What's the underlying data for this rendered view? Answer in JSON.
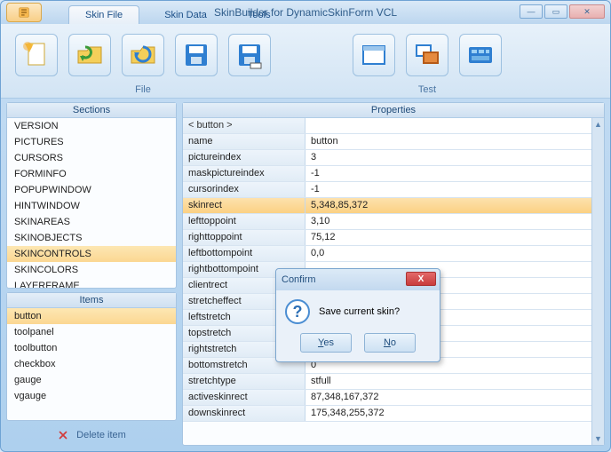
{
  "title": "SkinBuilder for DynamicSkinForm VCL",
  "tabs": [
    {
      "label": "Skin File",
      "active": true
    },
    {
      "label": "Skin Data",
      "active": false
    },
    {
      "label": "Tools",
      "active": false
    }
  ],
  "ribbon": {
    "groups": [
      {
        "label": "File",
        "icons": [
          "new-doc",
          "folder-refresh",
          "folder-recycle",
          "save",
          "save-as"
        ]
      },
      {
        "label": "Test",
        "icons": [
          "window-blank",
          "windows-cascade",
          "control-panel"
        ]
      }
    ]
  },
  "sections": {
    "header": "Sections",
    "items": [
      "VERSION",
      "PICTURES",
      "CURSORS",
      "FORMINFO",
      "POPUPWINDOW",
      "HINTWINDOW",
      "SKINAREAS",
      "SKINOBJECTS",
      "SKINCONTROLS",
      "SKINCOLORS",
      "LAYERFRAME"
    ],
    "selected": "SKINCONTROLS"
  },
  "items_panel": {
    "header": "Items",
    "items": [
      "button",
      "toolpanel",
      "toolbutton",
      "checkbox",
      "gauge",
      "vgauge"
    ],
    "selected": "button"
  },
  "delete_label": "Delete item",
  "properties": {
    "header": "Properties",
    "group": "< button >",
    "rows": [
      {
        "name": "name",
        "value": "button"
      },
      {
        "name": "pictureindex",
        "value": "3"
      },
      {
        "name": "maskpictureindex",
        "value": "-1"
      },
      {
        "name": "cursorindex",
        "value": "-1"
      },
      {
        "name": "skinrect",
        "value": "5,348,85,372",
        "hot": true
      },
      {
        "name": "lefttoppoint",
        "value": "3,10"
      },
      {
        "name": "righttoppoint",
        "value": "75,12"
      },
      {
        "name": "leftbottompoint",
        "value": "0,0"
      },
      {
        "name": "rightbottompoint",
        "value": ""
      },
      {
        "name": "clientrect",
        "value": ""
      },
      {
        "name": "stretcheffect",
        "value": ""
      },
      {
        "name": "leftstretch",
        "value": ""
      },
      {
        "name": "topstretch",
        "value": ""
      },
      {
        "name": "rightstretch",
        "value": ""
      },
      {
        "name": "bottomstretch",
        "value": "0"
      },
      {
        "name": "stretchtype",
        "value": "stfull"
      },
      {
        "name": "activeskinrect",
        "value": "87,348,167,372"
      },
      {
        "name": "downskinrect",
        "value": "175,348,255,372"
      }
    ]
  },
  "dialog": {
    "title": "Confirm",
    "message": "Save current skin?",
    "yes": "Yes",
    "no": "No"
  }
}
